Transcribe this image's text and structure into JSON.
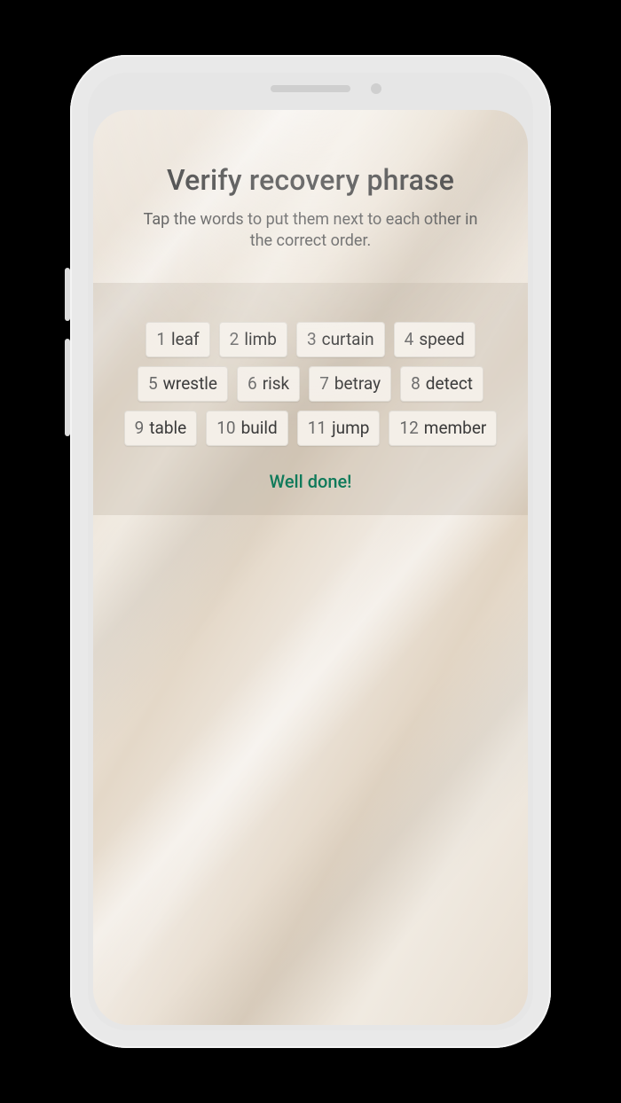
{
  "title": "Verify recovery phrase",
  "subtitle": "Tap the words to put them next to each other in the correct order.",
  "status_text": "Well done!",
  "status_color": "#0f7a5a",
  "words": [
    {
      "n": "1",
      "w": "leaf"
    },
    {
      "n": "2",
      "w": "limb"
    },
    {
      "n": "3",
      "w": "curtain"
    },
    {
      "n": "4",
      "w": "speed"
    },
    {
      "n": "5",
      "w": "wrestle"
    },
    {
      "n": "6",
      "w": "risk"
    },
    {
      "n": "7",
      "w": "betray"
    },
    {
      "n": "8",
      "w": "detect"
    },
    {
      "n": "9",
      "w": "table"
    },
    {
      "n": "10",
      "w": "build"
    },
    {
      "n": "11",
      "w": "jump"
    },
    {
      "n": "12",
      "w": "member"
    }
  ]
}
